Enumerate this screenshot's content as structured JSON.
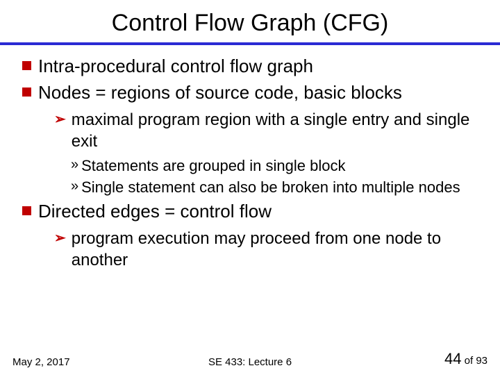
{
  "title": "Control Flow Graph (CFG)",
  "bullets": [
    {
      "text": "Intra-procedural control flow graph",
      "subs": []
    },
    {
      "text": "Nodes = regions of source code, basic blocks",
      "subs": [
        {
          "text": "maximal program region with a single entry and single exit",
          "subsubs": [
            {
              "text": "Statements are grouped in single block"
            },
            {
              "text": "Single statement can also be broken into multiple nodes"
            }
          ]
        }
      ]
    },
    {
      "text": "Directed edges = control flow",
      "subs": [
        {
          "text": "program execution may proceed from one node to another",
          "subsubs": []
        }
      ]
    }
  ],
  "footer": {
    "date": "May 2, 2017",
    "course": "SE 433: Lecture 6",
    "page_current": "44",
    "page_sep": " of ",
    "page_total": "93"
  }
}
